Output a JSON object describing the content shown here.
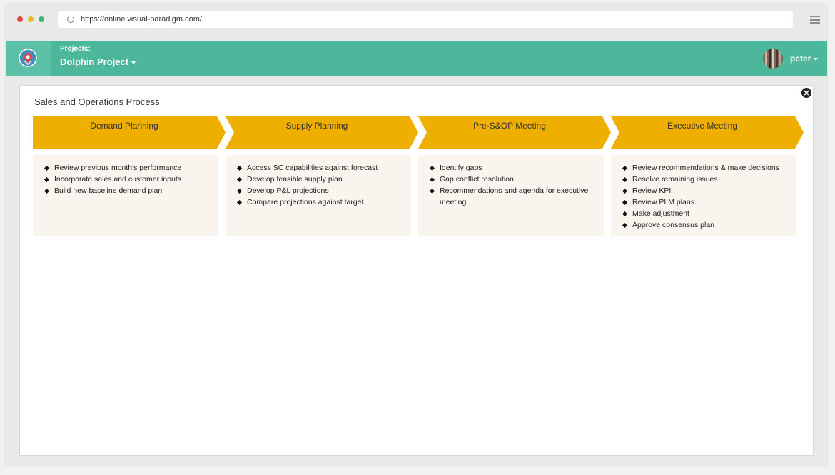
{
  "browser": {
    "url": "https://online.visual-paradigm.com/"
  },
  "appbar": {
    "projects_label": "Projects:",
    "project_name": "Dolphin Project",
    "username": "peter"
  },
  "colors": {
    "appbar": "#4cb79b",
    "chevron": "#eeaf00",
    "box": "#f9f5ee"
  },
  "diagram": {
    "title": "Sales and Operations Process",
    "stages": [
      {
        "label": "Demand Planning",
        "items": [
          "Review previous month's performance",
          "Incorporate sales and customer inputs",
          "Build new baseline demand plan"
        ]
      },
      {
        "label": "Supply Planning",
        "items": [
          "Access SC capabilities against forecast",
          "Develop feasible supply plan",
          "Develop P&L projections",
          "Compare projections against target"
        ]
      },
      {
        "label": "Pre-S&OP Meeting",
        "items": [
          "Identify gaps",
          "Gap conflict resolution",
          "Recommendations and agenda for executive meeting"
        ]
      },
      {
        "label": "Executive Meeting",
        "items": [
          "Review recommendations & make decisions",
          "Resolve remaining issues",
          "Review KPI",
          "Review PLM plans",
          "Make adjustment",
          "Approve consensus plan"
        ]
      }
    ]
  }
}
